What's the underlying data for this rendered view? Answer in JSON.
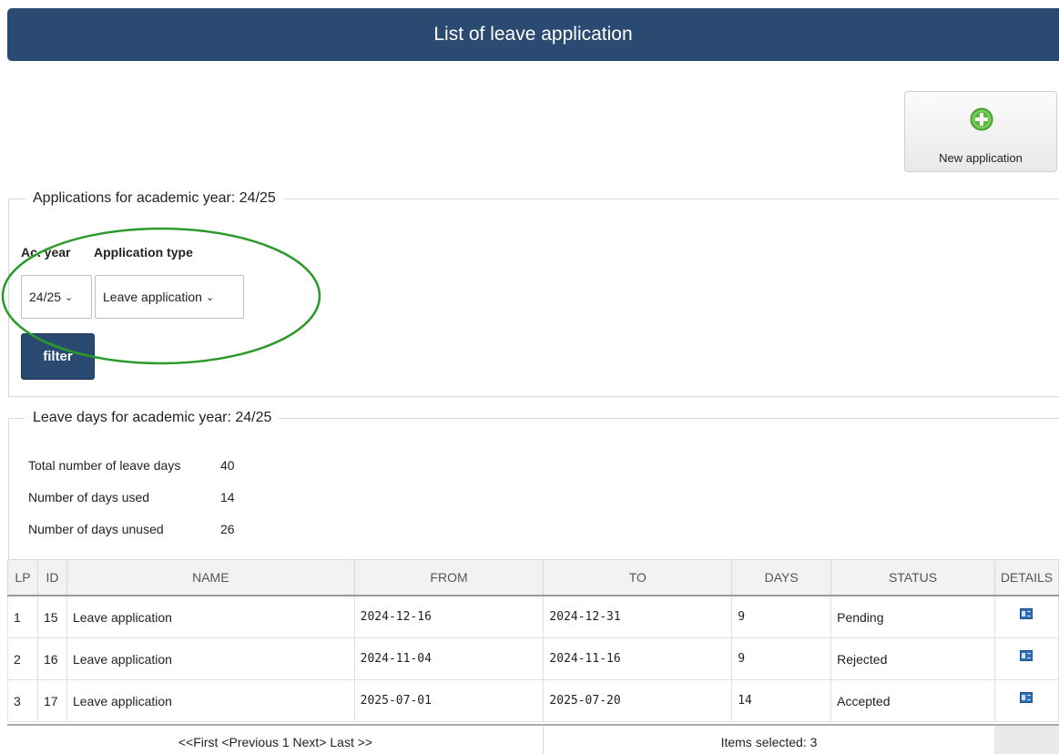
{
  "header": {
    "title": "List of leave application"
  },
  "actions": {
    "new_application_label": "New application",
    "new_application_icon": "plus-circle-icon"
  },
  "filters_section": {
    "legend": "Applications for academic year: 24/25",
    "ac_year_label": "Ac. year",
    "application_type_label": "Application type",
    "ac_year_value": "24/25",
    "application_type_value": "Leave application",
    "filter_button": "filter"
  },
  "leave_days_section": {
    "legend": "Leave days for academic year: 24/25",
    "stats": [
      {
        "label": "Total number of leave days",
        "value": "40"
      },
      {
        "label": "Number of days used",
        "value": "14"
      },
      {
        "label": "Number of days unused",
        "value": "26"
      }
    ]
  },
  "table": {
    "columns": [
      "LP",
      "ID",
      "NAME",
      "FROM",
      "TO",
      "DAYS",
      "STATUS",
      "DETAILS"
    ],
    "rows": [
      {
        "lp": "1",
        "id": "15",
        "name": "Leave application",
        "from": "2024-12-16",
        "to": "2024-12-31",
        "days": "9",
        "status": "Pending"
      },
      {
        "lp": "2",
        "id": "16",
        "name": "Leave application",
        "from": "2024-11-04",
        "to": "2024-11-16",
        "days": "9",
        "status": "Rejected"
      },
      {
        "lp": "3",
        "id": "17",
        "name": "Leave application",
        "from": "2025-07-01",
        "to": "2025-07-20",
        "days": "14",
        "status": "Accepted"
      }
    ],
    "pager": "<<First <Previous 1 Next> Last >>",
    "items_selected": "Items selected: 3"
  },
  "colors": {
    "header_bg": "#2a4a72",
    "annotation": "#2a9a2a",
    "plus_icon": "#5cb83c"
  }
}
